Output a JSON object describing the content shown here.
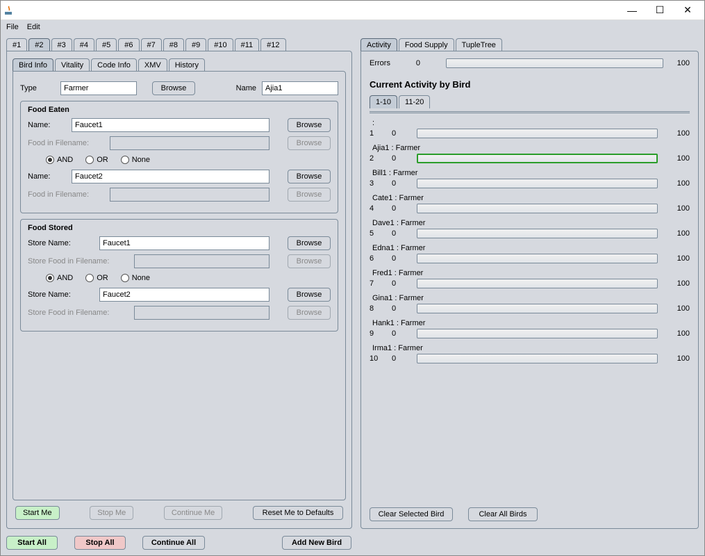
{
  "window": {
    "minimize": "—",
    "maximize": "☐",
    "close": "✕"
  },
  "menu": {
    "file": "File",
    "edit": "Edit"
  },
  "topTabs": [
    "#1",
    "#2",
    "#3",
    "#4",
    "#5",
    "#6",
    "#7",
    "#8",
    "#9",
    "#10",
    "#11",
    "#12"
  ],
  "topTabActive": 1,
  "innerTabs": [
    "Bird Info",
    "Vitality",
    "Code Info",
    "XMV",
    "History"
  ],
  "innerTabActive": 0,
  "typeRow": {
    "typeLabel": "Type",
    "typeValue": "Farmer",
    "browse": "Browse",
    "nameLabel": "Name",
    "nameValue": "Ajia1"
  },
  "foodEaten": {
    "title": "Food Eaten",
    "nameLabel": "Name:",
    "name1": "Faucet1",
    "name2": "Faucet2",
    "fifLabel": "Food in Filename:",
    "browse": "Browse",
    "radios": {
      "and": "AND",
      "or": "OR",
      "none": "None"
    }
  },
  "foodStored": {
    "title": "Food Stored",
    "storeLabel": "Store Name:",
    "name1": "Faucet1",
    "name2": "Faucet2",
    "sfifLabel": "Store Food in Filename:",
    "browse": "Browse",
    "radios": {
      "and": "AND",
      "or": "OR",
      "none": "None"
    }
  },
  "leftFooter": {
    "start": "Start Me",
    "stop": "Stop Me",
    "cont": "Continue Me",
    "reset": "Reset Me to Defaults"
  },
  "bottom": {
    "startAll": "Start All",
    "stopAll": "Stop All",
    "contAll": "Continue All",
    "addNew": "Add New Bird"
  },
  "rightTabs": [
    "Activity",
    "Food Supply",
    "TupleTree"
  ],
  "rightTabActive": 0,
  "errors": {
    "label": "Errors",
    "val": "0",
    "max": "100"
  },
  "activityTitle": "Current Activity by Bird",
  "pageTabs": [
    "1-10",
    "11-20"
  ],
  "pageTabActive": 0,
  "birds": [
    {
      "idx": "1",
      "top": ":",
      "val": "0",
      "max": "100",
      "hl": false
    },
    {
      "idx": "2",
      "top": "Ajia1 : Farmer",
      "val": "0",
      "max": "100",
      "hl": true
    },
    {
      "idx": "3",
      "top": "Bill1 : Farmer",
      "val": "0",
      "max": "100",
      "hl": false
    },
    {
      "idx": "4",
      "top": "Cate1 : Farmer",
      "val": "0",
      "max": "100",
      "hl": false
    },
    {
      "idx": "5",
      "top": "Dave1 : Farmer",
      "val": "0",
      "max": "100",
      "hl": false
    },
    {
      "idx": "6",
      "top": "Edna1 : Farmer",
      "val": "0",
      "max": "100",
      "hl": false
    },
    {
      "idx": "7",
      "top": "Fred1 : Farmer",
      "val": "0",
      "max": "100",
      "hl": false
    },
    {
      "idx": "8",
      "top": "Gina1 : Farmer",
      "val": "0",
      "max": "100",
      "hl": false
    },
    {
      "idx": "9",
      "top": "Hank1 : Farmer",
      "val": "0",
      "max": "100",
      "hl": false
    },
    {
      "idx": "10",
      "top": "Irma1 : Farmer",
      "val": "0",
      "max": "100",
      "hl": false
    }
  ],
  "rightFooter": {
    "clearSel": "Clear Selected Bird",
    "clearAll": "Clear All Birds"
  }
}
